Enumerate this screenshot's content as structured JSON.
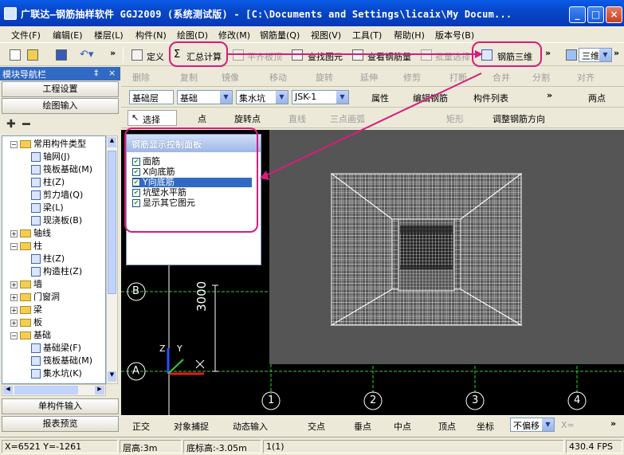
{
  "window": {
    "title": "广联达—钢筋抽样软件 GGJ2009 (系统测试版) - [C:\\Documents and Settings\\licaix\\My Docum...",
    "minimize": "_",
    "maximize": "□",
    "close": "×"
  },
  "menu": [
    "文件(F)",
    "编辑(E)",
    "楼层(L)",
    "构件(N)",
    "绘图(D)",
    "修改(M)",
    "钢筋量(Q)",
    "视图(V)",
    "工具(T)",
    "帮助(H)",
    "版本号(B)"
  ],
  "toolbar1": {
    "define": "定义",
    "sum_calc": "汇总计算",
    "flat_edit": "平齐板顶",
    "find_elem": "查找图元",
    "view_rebar": "查看钢筋量",
    "batch_select": "批量选择",
    "rebar_3d": "钢筋三维",
    "view_mode": "三维"
  },
  "toolbar2": [
    "删除",
    "复制",
    "镜像",
    "移动",
    "旋转",
    "延伸",
    "修剪",
    "打断",
    "合并",
    "分割",
    "对齐"
  ],
  "toolbar3": {
    "floor_type": "基础层",
    "floor": "基础",
    "component_type": "集水坑",
    "component": "JSK-1",
    "attributes": "属性",
    "edit_rebar": "编辑钢筋",
    "component_list": "构件列表",
    "two_points": "两点"
  },
  "toolbar4": {
    "select": "选择",
    "point": "点",
    "rotate_point": "旋转点",
    "line": "直线",
    "arc3": "三点画弧",
    "rect": "矩形",
    "adjust_dir": "调整钢筋方向"
  },
  "nav": {
    "title": "模块导航栏",
    "pin": "‡",
    "close": "×",
    "project_settings": "工程设置",
    "drawing_input": "绘图输入",
    "single_input": "单构件输入",
    "report": "报表预览"
  },
  "tree": [
    {
      "label": "常用构件类型",
      "level": 0,
      "expanded": true
    },
    {
      "label": "轴网(J)",
      "level": 1
    },
    {
      "label": "筏板基础(M)",
      "level": 1
    },
    {
      "label": "柱(Z)",
      "level": 1
    },
    {
      "label": "剪力墙(Q)",
      "level": 1
    },
    {
      "label": "梁(L)",
      "level": 1
    },
    {
      "label": "现浇板(B)",
      "level": 1
    },
    {
      "label": "轴线",
      "level": 0,
      "expanded": false
    },
    {
      "label": "柱",
      "level": 0,
      "expanded": true
    },
    {
      "label": "柱(Z)",
      "level": 1
    },
    {
      "label": "构造柱(Z)",
      "level": 1
    },
    {
      "label": "墙",
      "level": 0,
      "expanded": false
    },
    {
      "label": "门窗洞",
      "level": 0,
      "expanded": false
    },
    {
      "label": "梁",
      "level": 0,
      "expanded": false
    },
    {
      "label": "板",
      "level": 0,
      "expanded": false
    },
    {
      "label": "基础",
      "level": 0,
      "expanded": true
    },
    {
      "label": "基础梁(F)",
      "level": 1
    },
    {
      "label": "筏板基础(M)",
      "level": 1
    },
    {
      "label": "集水坑(K)",
      "level": 1
    }
  ],
  "popup": {
    "title": "钢筋显示控制面板",
    "options": [
      {
        "label": "面筋",
        "checked": true,
        "selected": false
      },
      {
        "label": "X向底筋",
        "checked": true,
        "selected": false
      },
      {
        "label": "Y向底筋",
        "checked": true,
        "selected": true
      },
      {
        "label": "坑壁水平筋",
        "checked": true,
        "selected": false
      },
      {
        "label": "显示其它图元",
        "checked": true,
        "selected": false
      }
    ]
  },
  "grid_labels": {
    "axisB": "B",
    "axisA": "A",
    "dim": "3000",
    "col1": "1",
    "col2": "2",
    "col3": "3",
    "col4": "4",
    "z": "Z",
    "y": "Y"
  },
  "snap": {
    "ortho": "正交",
    "snap": "对象捕捉",
    "dyn": "动态输入",
    "intersect": "交点",
    "perp": "垂点",
    "mid": "中点",
    "vertex": "顶点",
    "coord": "坐标",
    "offset": "不偏移",
    "x": "X="
  },
  "status": {
    "xy": "X=6521 Y=-1261",
    "floor_height": "层高:3m",
    "base_elev": "底标高:-3.05m",
    "count": "1(1)",
    "fps": "430.4 FPS"
  },
  "colors": {
    "accent": "#d81c7c",
    "titlebar": "#0a5ce8",
    "grid": "#2fd22f",
    "cad_bg": "#000000",
    "view3d": "#555555"
  }
}
